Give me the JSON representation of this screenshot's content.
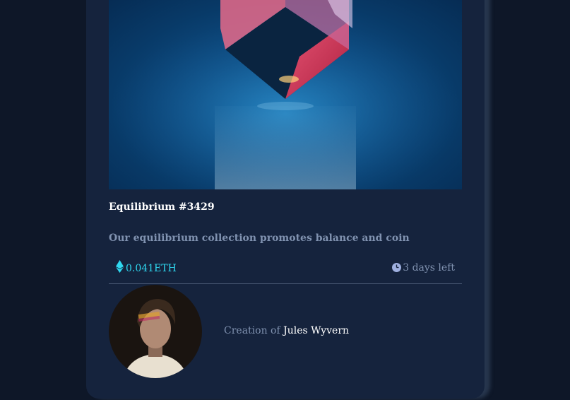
{
  "nft": {
    "title": "Equilibrium #3429",
    "description": "Our equilibrium collection promotes balance and coin",
    "price": "0.041ETH",
    "time_left": "3 days left",
    "creator_prefix": "Creation of ",
    "creator_name": "Jules Wyvern"
  },
  "icons": {
    "price": "ethereum-icon",
    "time": "clock-icon"
  },
  "colors": {
    "background": "#0e1728",
    "card": "#15233d",
    "accent": "#2fd8f0",
    "muted": "#8092b0",
    "text": "#ffffff"
  }
}
